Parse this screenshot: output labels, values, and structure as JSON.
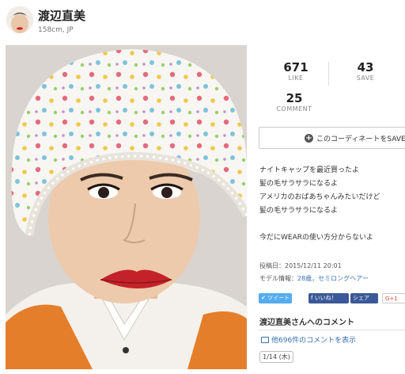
{
  "user": {
    "name": "渡辺直美",
    "meta": "158cm, JP"
  },
  "stats": {
    "like": {
      "value": "671",
      "label": "LIKE"
    },
    "save": {
      "value": "43",
      "label": "SAVE"
    },
    "comment": {
      "value": "25",
      "label": "COMMENT"
    }
  },
  "save_button": {
    "label": "このコーディネートをSAVE"
  },
  "description": [
    "ナイトキャップを最近買ったよ",
    "髪の毛サラサラになるよ",
    "アメリカのおばあちゃんみたいだけど",
    "髪の毛サラサラになるよ",
    "",
    "今だにWEARの使い方分からないよ"
  ],
  "post_meta": {
    "posted_label": "投稿日：",
    "posted_value": "2015/12/11 20:01",
    "model_label": "モデル情報：",
    "model_value": "28歳，セミロングヘアー"
  },
  "share": {
    "tweet": "ツイート",
    "like": "いいね！",
    "share": "シェア",
    "gplus": "G+1"
  },
  "comments": {
    "title": "渡辺直美さんへのコメント",
    "more_link": "他696件のコメントを表示",
    "date": "1/14 (木)"
  },
  "colors": {
    "link": "#3a6fb0",
    "twitter": "#55acee",
    "facebook": "#3b5998",
    "lipstick": "#c4222a"
  }
}
